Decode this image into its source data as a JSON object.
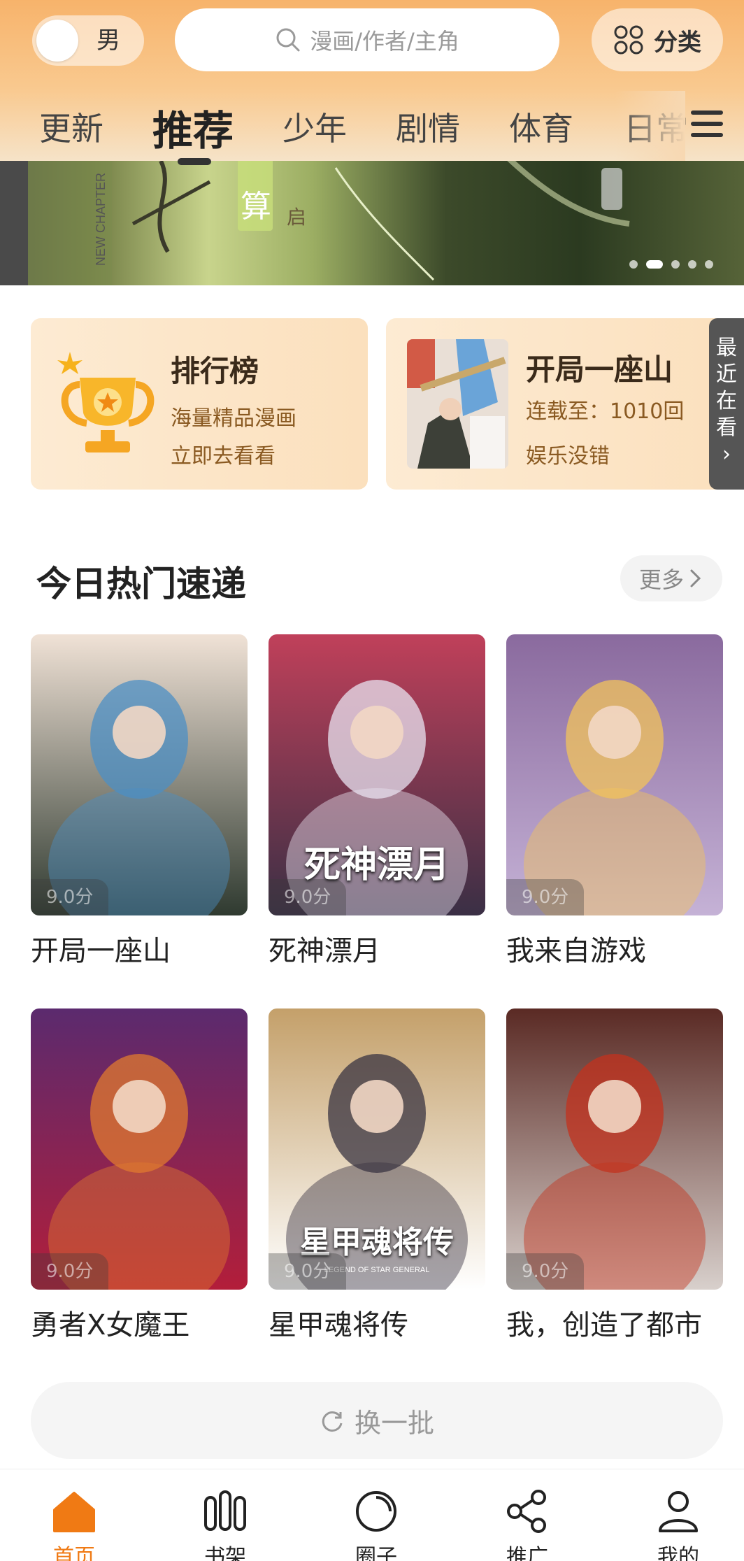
{
  "header": {
    "gender_label": "男",
    "search_placeholder": "漫画/作者/主角",
    "category_label": "分类"
  },
  "tabs": [
    {
      "label": "更新"
    },
    {
      "label": "推荐",
      "active": true
    },
    {
      "label": "少年"
    },
    {
      "label": "剧情"
    },
    {
      "label": "体育"
    },
    {
      "label": "日常"
    }
  ],
  "banner": {
    "text_new_chapter": "NEW CHAPTER",
    "text_calc": "算",
    "text_start": "启",
    "dot_count": 5,
    "active_dot": 1
  },
  "feature_cards": {
    "ranking": {
      "title": "排行榜",
      "subtitle": "海量精品漫画",
      "action": "立即去看看"
    },
    "serial": {
      "title": "开局一座山",
      "progress": "连载至：1010回",
      "tagline": "娱乐没错"
    }
  },
  "recent_tab": {
    "chars": [
      "最",
      "近",
      "在",
      "看"
    ],
    "arrow": "›"
  },
  "section": {
    "title": "今日热门速递",
    "more_label": "更多"
  },
  "comics": [
    {
      "title": "开局一座山",
      "score": "9.0分",
      "palette": [
        "#f0e2d6",
        "#4c8fc4",
        "#2f3a30"
      ]
    },
    {
      "title": "死神漂月",
      "score": "9.0分",
      "palette": [
        "#c0405a",
        "#e8e3f0",
        "#3a2f45"
      ],
      "cover_text": "死神漂月"
    },
    {
      "title": "我来自游戏",
      "score": "9.0分",
      "palette": [
        "#8a6a9e",
        "#f1c35b",
        "#c5b2d6"
      ]
    },
    {
      "title": "勇者X女魔王",
      "score": "9.0分",
      "palette": [
        "#5b2a6e",
        "#e0792f",
        "#b31e3a"
      ]
    },
    {
      "title": "星甲魂将传",
      "score": "9.0分",
      "palette": [
        "#c4a06a",
        "#3a3442",
        "#ffffff"
      ],
      "cover_text": "星甲魂将传",
      "cover_subtext": "LEGEND OF STAR GENERAL"
    },
    {
      "title": "我，创造了都市",
      "score": "9.0分",
      "palette": [
        "#5a2a24",
        "#c3321d",
        "#d8d0cc"
      ]
    }
  ],
  "refresh_label": "换一批",
  "bottom_nav": [
    {
      "label": "首页",
      "icon": "home-icon",
      "active": true
    },
    {
      "label": "书架",
      "icon": "bookshelf-icon"
    },
    {
      "label": "圈子",
      "icon": "circle-icon"
    },
    {
      "label": "推广",
      "icon": "share-icon"
    },
    {
      "label": "我的",
      "icon": "profile-icon"
    }
  ],
  "colors": {
    "accent": "#f07a14",
    "header_top": "#f7b36b",
    "card_bg": "#fbe0bd"
  }
}
